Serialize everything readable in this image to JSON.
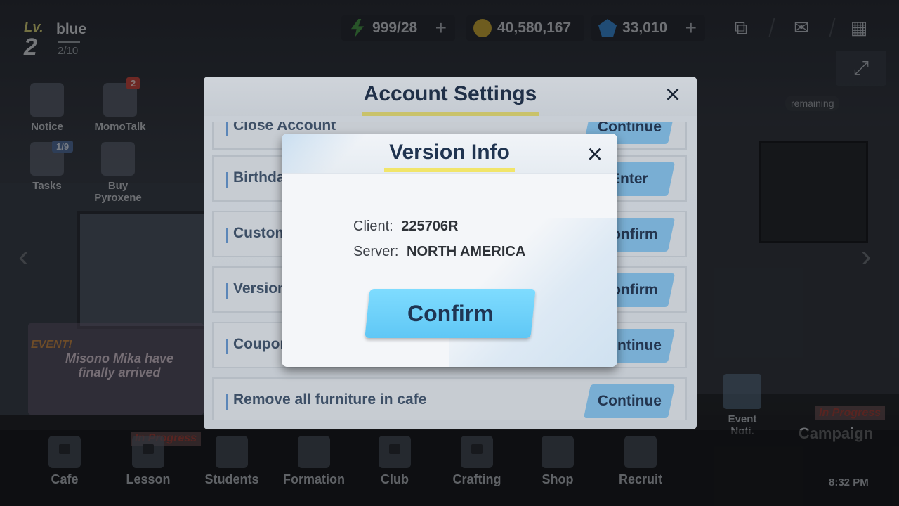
{
  "player": {
    "lv_label": "Lv.",
    "level": "2",
    "name": "blue",
    "exp": "2/10"
  },
  "resources": [
    {
      "icon": "ap-bolt-icon",
      "value": "999/28",
      "plus": "+"
    },
    {
      "icon": "credit-coin-icon",
      "value": "40,580,167"
    },
    {
      "icon": "pyroxene-gem-icon",
      "value": "33,010",
      "plus": "+"
    }
  ],
  "top_icons": {
    "share": "⧉",
    "mail": "✉",
    "menu": "▦",
    "expand": "⤢"
  },
  "left_menu": [
    {
      "label": "Notice"
    },
    {
      "label": "MomoTalk",
      "badge": "2"
    },
    {
      "label": "Tasks",
      "badge": "1/9"
    },
    {
      "label": "Buy Pyroxene"
    }
  ],
  "event_banner": {
    "tag": "EVENT!",
    "title": "Misono Mika have finally arrived"
  },
  "right_panel": {
    "remaining": "remaining",
    "event_noti": "Event Noti.",
    "campaign": "Campaign",
    "in_progress": "In Progress"
  },
  "bottom_nav": [
    {
      "label": "Cafe"
    },
    {
      "label": "Lesson",
      "status": "In Progress"
    },
    {
      "label": "Students"
    },
    {
      "label": "Formation"
    },
    {
      "label": "Club"
    },
    {
      "label": "Crafting"
    },
    {
      "label": "Shop"
    },
    {
      "label": "Recruit"
    }
  ],
  "clock": "8:32 PM",
  "account_settings": {
    "title": "Account Settings",
    "close_icon": "×",
    "rows": [
      {
        "label": "Close Account",
        "button": "Continue"
      },
      {
        "label": "Birthday",
        "button": "Enter"
      },
      {
        "label": "Customer",
        "button": "Confirm"
      },
      {
        "label": "Version",
        "button": "Confirm"
      },
      {
        "label": "Coupon",
        "button": "Continue"
      },
      {
        "label": "Remove all furniture in cafe",
        "button": "Continue"
      }
    ]
  },
  "version_info": {
    "title": "Version Info",
    "close_icon": "×",
    "client_label": "Client:",
    "client_value": "225706R",
    "server_label": "Server:",
    "server_value": "NORTH AMERICA",
    "confirm_label": "Confirm"
  }
}
